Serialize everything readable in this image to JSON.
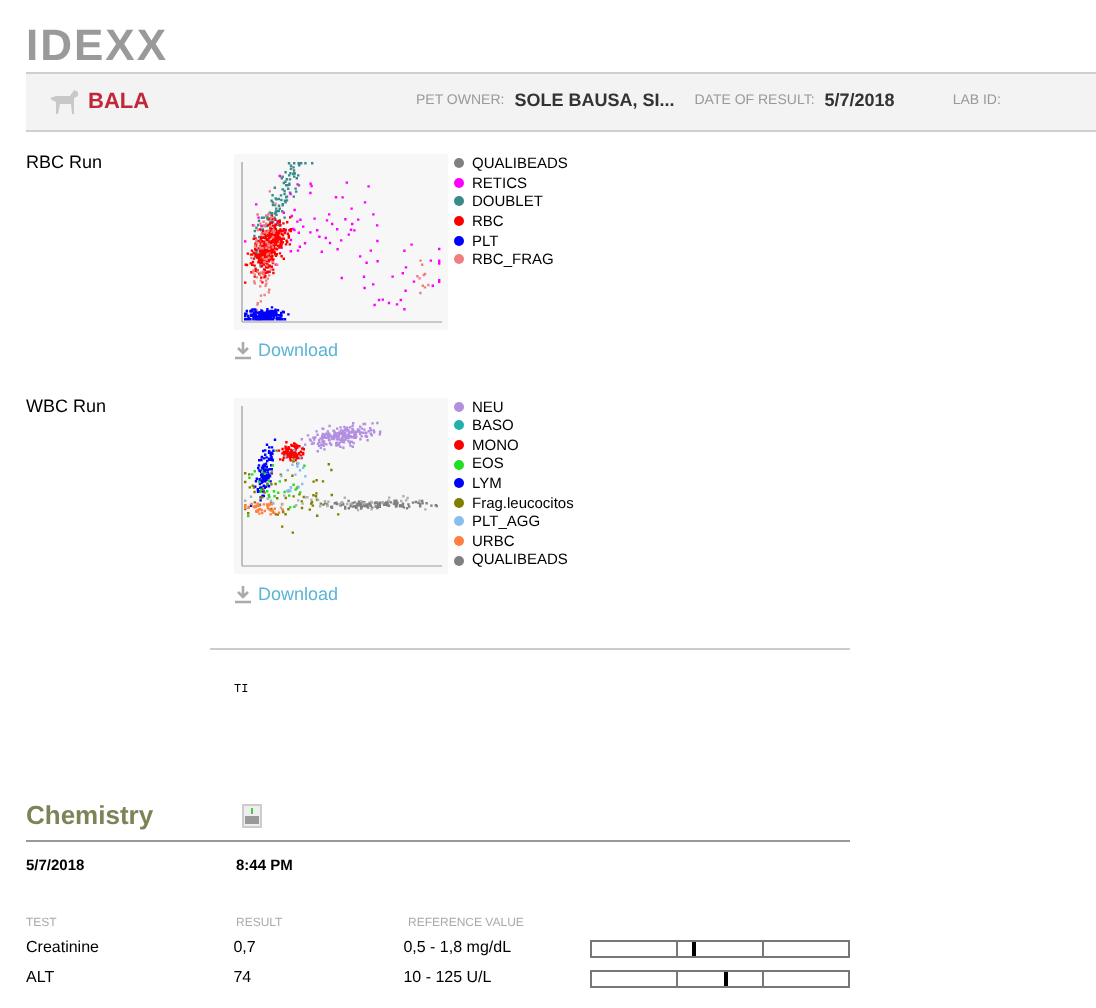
{
  "logo": "IDEXX",
  "patient": {
    "name": "BALA",
    "owner_label": "PET OWNER:",
    "owner": "SOLE BAUSA, SI...",
    "date_label": "DATE OF RESULT:",
    "date": "5/7/2018",
    "lab_label": "LAB ID:"
  },
  "runs": [
    {
      "title": "RBC Run",
      "kind": "rbc",
      "download": "Download",
      "legend": [
        {
          "label": "QUALIBEADS",
          "color": "#808080"
        },
        {
          "label": "RETICS",
          "color": "#ff00ff"
        },
        {
          "label": "DOUBLET",
          "color": "#3a8a8a"
        },
        {
          "label": "RBC",
          "color": "#ff0000"
        },
        {
          "label": "PLT",
          "color": "#0000ff"
        },
        {
          "label": "RBC_FRAG",
          "color": "#f08080"
        }
      ]
    },
    {
      "title": "WBC Run",
      "kind": "wbc",
      "download": "Download",
      "legend": [
        {
          "label": "NEU",
          "color": "#b38fe0"
        },
        {
          "label": "BASO",
          "color": "#20b2aa"
        },
        {
          "label": "MONO",
          "color": "#ff0000"
        },
        {
          "label": "EOS",
          "color": "#22dd22"
        },
        {
          "label": "LYM",
          "color": "#0000ff"
        },
        {
          "label": "Frag.leucocitos",
          "color": "#808000"
        },
        {
          "label": "PLT_AGG",
          "color": "#87bdf0"
        },
        {
          "label": "URBC",
          "color": "#ff8040"
        },
        {
          "label": "QUALIBEADS",
          "color": "#808080"
        }
      ]
    }
  ],
  "note": "TI",
  "chemistry": {
    "title": "Chemistry",
    "date": "5/7/2018",
    "time": "8:44 PM",
    "columns": [
      "TEST",
      "RESULT",
      "REFERENCE VALUE"
    ],
    "rows": [
      {
        "test": "Creatinine",
        "result": "0,7",
        "reference": "0,5 - 1,8 mg/dL",
        "level": 0.39
      },
      {
        "test": "ALT",
        "result": "74",
        "reference": "10 - 125 U/L",
        "level": 0.52
      }
    ]
  }
}
